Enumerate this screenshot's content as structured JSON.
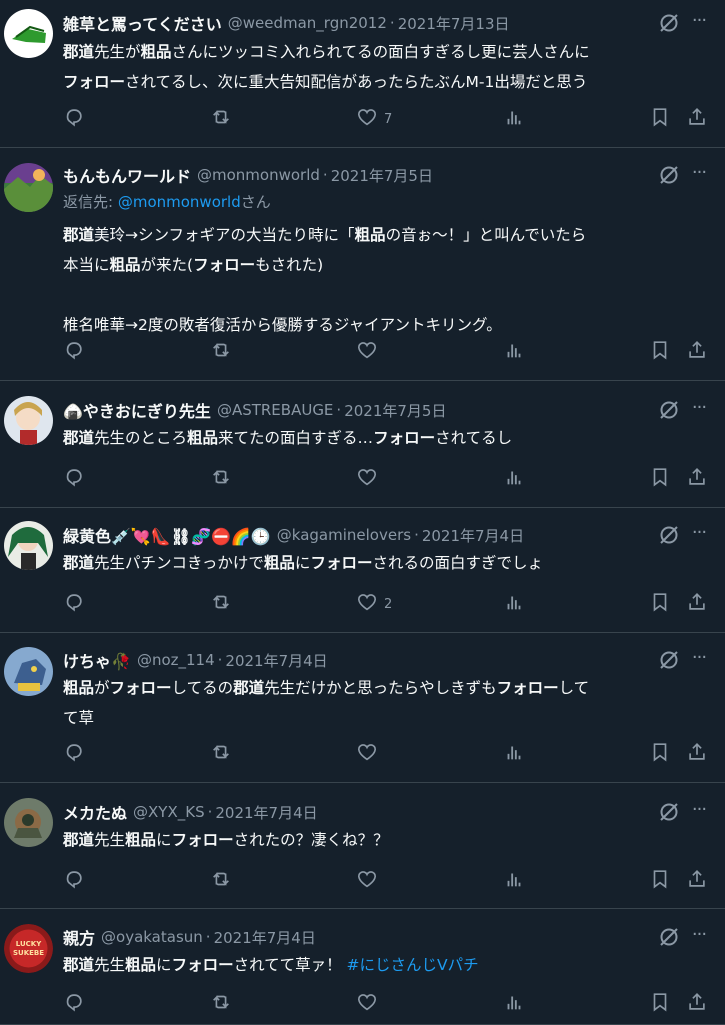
{
  "tweets": [
    {
      "name": "雑草と罵ってください",
      "handle": "@weedman_rgn2012",
      "date": "2021年7月13日",
      "reply_to": null,
      "segments": [
        {
          "t": "郡道",
          "b": true
        },
        {
          "t": "先生が",
          "b": false
        },
        {
          "t": "粗品",
          "b": true
        },
        {
          "t": "さんにツッコミ入れられてるの面白すぎるし更に芸人さんに",
          "b": false
        },
        {
          "t": "\n",
          "b": false
        },
        {
          "t": "フォロー",
          "b": true
        },
        {
          "t": "されてるし、次に重大告知配信があったらたぶんM-1出場だと思う",
          "b": false
        }
      ],
      "like_count": "7",
      "avatar": "green-grass"
    },
    {
      "name": "もんもんワールド",
      "handle": "@monmonworld",
      "date": "2021年7月5日",
      "reply_to": {
        "prefix": "返信先: ",
        "handle": "@monmonworld",
        "suffix": "さん"
      },
      "segments": [
        {
          "t": "郡道",
          "b": true
        },
        {
          "t": "美玲→シンフォギアの大当たり時に「",
          "b": false
        },
        {
          "t": "粗品",
          "b": true
        },
        {
          "t": "の音ぉ～！」と叫んでいたら",
          "b": false
        },
        {
          "t": "\n",
          "b": false
        },
        {
          "t": "本当に",
          "b": false
        },
        {
          "t": "粗品",
          "b": true
        },
        {
          "t": "が来た(",
          "b": false
        },
        {
          "t": "フォロー",
          "b": true
        },
        {
          "t": "もされた)",
          "b": false
        },
        {
          "t": "\n\n",
          "b": false
        },
        {
          "t": "椎名唯華→2度の敗者復活から優勝するジャイアントキリング。",
          "b": false
        }
      ],
      "like_count": "",
      "avatar": "landscape"
    },
    {
      "name": "🍙やきおにぎり先生",
      "handle": "@ASTREBAUGE",
      "date": "2021年7月5日",
      "reply_to": null,
      "segments": [
        {
          "t": "郡道",
          "b": true
        },
        {
          "t": "先生のところ",
          "b": false
        },
        {
          "t": "粗品",
          "b": true
        },
        {
          "t": "来てたの面白すぎる…",
          "b": false
        },
        {
          "t": "フォロー",
          "b": true
        },
        {
          "t": "されてるし",
          "b": false
        }
      ],
      "like_count": "",
      "avatar": "anime-girl"
    },
    {
      "name": "緑黄色💉💘👠⛓🧬⛔🌈🕒",
      "handle": "@kagaminelovers",
      "date": "2021年7月4日",
      "reply_to": null,
      "segments": [
        {
          "t": "郡道",
          "b": true
        },
        {
          "t": "先生パチンコきっかけで",
          "b": false
        },
        {
          "t": "粗品",
          "b": true
        },
        {
          "t": "に",
          "b": false
        },
        {
          "t": "フォロー",
          "b": true
        },
        {
          "t": "されるの面白すぎでしょ",
          "b": false
        }
      ],
      "like_count": "2",
      "avatar": "green-character"
    },
    {
      "name": "けちゃ🥀",
      "handle": "@noz_114",
      "date": "2021年7月4日",
      "reply_to": null,
      "segments": [
        {
          "t": "粗品",
          "b": true
        },
        {
          "t": "が",
          "b": false
        },
        {
          "t": "フォロー",
          "b": true
        },
        {
          "t": "してるの",
          "b": false
        },
        {
          "t": "郡道",
          "b": true
        },
        {
          "t": "先生だけかと思ったらやしきずも",
          "b": false
        },
        {
          "t": "フォロー",
          "b": true
        },
        {
          "t": "して",
          "b": false
        },
        {
          "t": "\n",
          "b": false
        },
        {
          "t": "て草",
          "b": false
        }
      ],
      "like_count": "",
      "avatar": "blue-creature"
    },
    {
      "name": "メカたぬ",
      "handle": "@XYX_KS",
      "date": "2021年7月4日",
      "reply_to": null,
      "segments": [
        {
          "t": "郡道",
          "b": true
        },
        {
          "t": "先生",
          "b": false
        },
        {
          "t": "粗品",
          "b": true
        },
        {
          "t": "に",
          "b": false
        },
        {
          "t": "フォロー",
          "b": true
        },
        {
          "t": "されたの？凄くね？？",
          "b": false
        }
      ],
      "like_count": "",
      "avatar": "mech"
    },
    {
      "name": "親方",
      "handle": "@oyakatasun",
      "date": "2021年7月4日",
      "reply_to": null,
      "segments": [
        {
          "t": "郡道",
          "b": true
        },
        {
          "t": "先生",
          "b": false
        },
        {
          "t": "粗品",
          "b": true
        },
        {
          "t": "に",
          "b": false
        },
        {
          "t": "フォロー",
          "b": true
        },
        {
          "t": "されてて草ァ！ ",
          "b": false
        },
        {
          "t": "#にじさんじVパチ",
          "b": false,
          "link": true
        }
      ],
      "like_count": "",
      "avatar": "lucky-sukebe",
      "avatar_text": "LUCKY SUKEBE"
    }
  ],
  "colors": {
    "bg": "#15202b",
    "text": "#f7f9f9",
    "muted": "#8b98a5",
    "link": "#1d9bf0",
    "border": "#38444d"
  },
  "icons": [
    "grok-icon",
    "more-icon",
    "reply-icon",
    "retweet-icon",
    "like-icon",
    "views-icon",
    "bookmark-icon",
    "share-icon"
  ]
}
